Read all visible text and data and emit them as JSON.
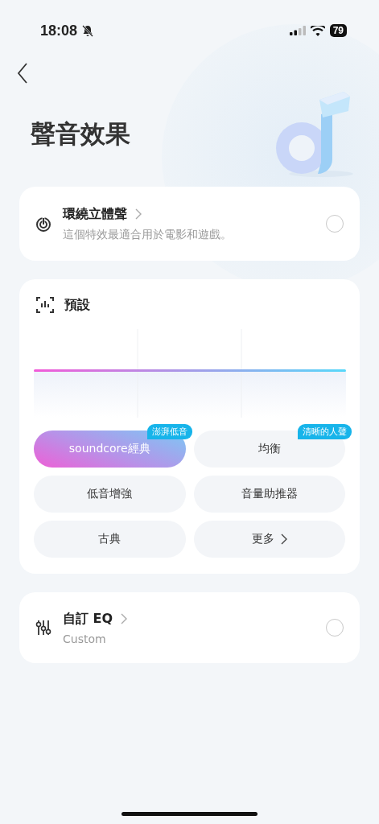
{
  "status_bar": {
    "time": "18:08",
    "muted": true,
    "battery": "79"
  },
  "title": "聲音效果",
  "surround": {
    "title": "環繞立體聲",
    "subtitle": "這個特效最適合用於電影和遊戲。",
    "selected": false
  },
  "preset": {
    "title": "預設",
    "presets": [
      {
        "label": "soundcore經典",
        "selected": true,
        "badge": "澎湃低音",
        "kind": "preset"
      },
      {
        "label": "均衡",
        "selected": false,
        "badge": "清晰的人聲",
        "kind": "preset"
      },
      {
        "label": "低音增強",
        "selected": false,
        "kind": "preset"
      },
      {
        "label": "音量助推器",
        "selected": false,
        "kind": "preset"
      },
      {
        "label": "古典",
        "selected": false,
        "kind": "preset"
      },
      {
        "label": "更多",
        "selected": false,
        "kind": "more"
      }
    ]
  },
  "custom": {
    "title": "自訂 EQ",
    "subtitle": "Custom",
    "selected": false
  }
}
